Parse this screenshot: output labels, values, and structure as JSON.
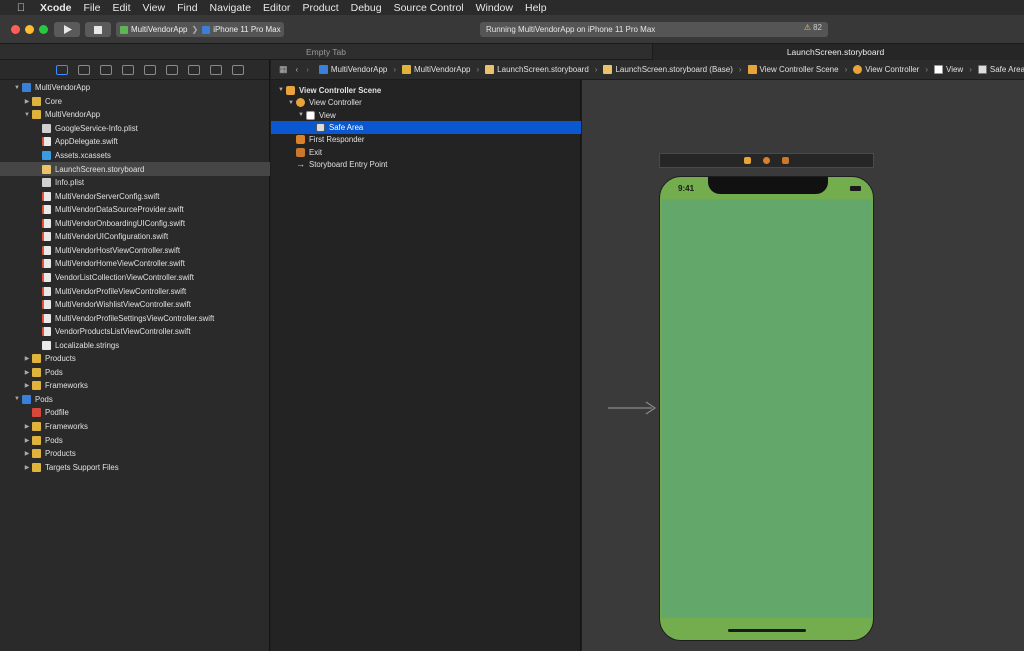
{
  "menubar": {
    "items": [
      "Xcode",
      "File",
      "Edit",
      "View",
      "Find",
      "Navigate",
      "Editor",
      "Product",
      "Debug",
      "Source Control",
      "Window",
      "Help"
    ]
  },
  "toolbar": {
    "scheme": "MultiVendorApp",
    "device": "iPhone 11 Pro Max",
    "activity": "Running MultiVendorApp on iPhone 11 Pro Max",
    "warning_count": "82"
  },
  "tabs": {
    "empty": "Empty Tab",
    "active": "LaunchScreen.storyboard"
  },
  "navigator": {
    "rows": [
      {
        "label": "MultiVendorApp",
        "icon": "project-icon",
        "level": 0,
        "disclosure": "open"
      },
      {
        "label": "Core",
        "icon": "folder-icon",
        "level": 1,
        "disclosure": "closed"
      },
      {
        "label": "MultiVendorApp",
        "icon": "folder-icon",
        "level": 1,
        "disclosure": "open"
      },
      {
        "label": "GoogleService-Info.plist",
        "icon": "plist-icon",
        "level": 2,
        "disclosure": ""
      },
      {
        "label": "AppDelegate.swift",
        "icon": "swift-icon",
        "level": 2,
        "disclosure": ""
      },
      {
        "label": "Assets.xcassets",
        "icon": "assets-icon",
        "level": 2,
        "disclosure": ""
      },
      {
        "label": "LaunchScreen.storyboard",
        "icon": "storyboard-icon",
        "level": 2,
        "disclosure": "",
        "selected": true
      },
      {
        "label": "Info.plist",
        "icon": "plist-icon",
        "level": 2,
        "disclosure": ""
      },
      {
        "label": "MultiVendorServerConfig.swift",
        "icon": "swift-icon",
        "level": 2,
        "disclosure": ""
      },
      {
        "label": "MultiVendorDataSourceProvider.swift",
        "icon": "swift-icon",
        "level": 2,
        "disclosure": ""
      },
      {
        "label": "MultiVendorOnboardingUIConfig.swift",
        "icon": "swift-icon",
        "level": 2,
        "disclosure": ""
      },
      {
        "label": "MultiVendorUIConfiguration.swift",
        "icon": "swift-icon",
        "level": 2,
        "disclosure": ""
      },
      {
        "label": "MultiVendorHostViewController.swift",
        "icon": "swift-icon",
        "level": 2,
        "disclosure": ""
      },
      {
        "label": "MultiVendorHomeViewController.swift",
        "icon": "swift-icon",
        "level": 2,
        "disclosure": ""
      },
      {
        "label": "VendorListCollectionViewController.swift",
        "icon": "swift-icon",
        "level": 2,
        "disclosure": ""
      },
      {
        "label": "MultiVendorProfileViewController.swift",
        "icon": "swift-icon",
        "level": 2,
        "disclosure": ""
      },
      {
        "label": "MultiVendorWishlistViewController.swift",
        "icon": "swift-icon",
        "level": 2,
        "disclosure": ""
      },
      {
        "label": "MultiVendorProfileSettingsViewController.swift",
        "icon": "swift-icon",
        "level": 2,
        "disclosure": ""
      },
      {
        "label": "VendorProductsListViewController.swift",
        "icon": "swift-icon",
        "level": 2,
        "disclosure": ""
      },
      {
        "label": "Localizable.strings",
        "icon": "strings-icon",
        "level": 2,
        "disclosure": ""
      },
      {
        "label": "Products",
        "icon": "folder-icon",
        "level": 1,
        "disclosure": "closed"
      },
      {
        "label": "Pods",
        "icon": "folder-icon",
        "level": 1,
        "disclosure": "closed"
      },
      {
        "label": "Frameworks",
        "icon": "folder-icon",
        "level": 1,
        "disclosure": "closed"
      },
      {
        "label": "Pods",
        "icon": "project-icon",
        "level": 0,
        "disclosure": "open"
      },
      {
        "label": "Podfile",
        "icon": "podfile-icon",
        "level": 1,
        "disclosure": ""
      },
      {
        "label": "Frameworks",
        "icon": "folder-icon",
        "level": 1,
        "disclosure": "closed"
      },
      {
        "label": "Pods",
        "icon": "folder-icon",
        "level": 1,
        "disclosure": "closed"
      },
      {
        "label": "Products",
        "icon": "folder-icon",
        "level": 1,
        "disclosure": "closed"
      },
      {
        "label": "Targets Support Files",
        "icon": "folder-icon",
        "level": 1,
        "disclosure": "closed"
      }
    ]
  },
  "jumpbar": {
    "crumbs": [
      "MultiVendorApp",
      "MultiVendorApp",
      "LaunchScreen.storyboard",
      "LaunchScreen.storyboard (Base)",
      "View Controller Scene",
      "View Controller",
      "View",
      "Safe Area"
    ]
  },
  "outline": {
    "rows": [
      {
        "label": "View Controller Scene",
        "level": 0,
        "disclosure": "open",
        "bold": true,
        "icon": "scene-icon"
      },
      {
        "label": "View Controller",
        "level": 1,
        "disclosure": "open",
        "icon": "view-controller-icon"
      },
      {
        "label": "View",
        "level": 2,
        "disclosure": "open",
        "icon": "view-icon"
      },
      {
        "label": "Safe Area",
        "level": 3,
        "disclosure": "",
        "icon": "safe-area-icon",
        "selected": true
      },
      {
        "label": "First Responder",
        "level": 1,
        "disclosure": "",
        "icon": "first-responder-icon"
      },
      {
        "label": "Exit",
        "level": 1,
        "disclosure": "",
        "icon": "exit-icon"
      },
      {
        "label": "Storyboard Entry Point",
        "level": 1,
        "disclosure": "",
        "icon": "entry-point-icon"
      }
    ]
  },
  "canvas": {
    "status_time": "9:41"
  },
  "colors": {
    "selection": "#0a57d0",
    "launch_green": "#74ad4d",
    "safe_area_green": "#63a86a",
    "traffic_red": "#fe5f57",
    "traffic_yellow": "#febc2e",
    "traffic_green": "#28c840"
  }
}
